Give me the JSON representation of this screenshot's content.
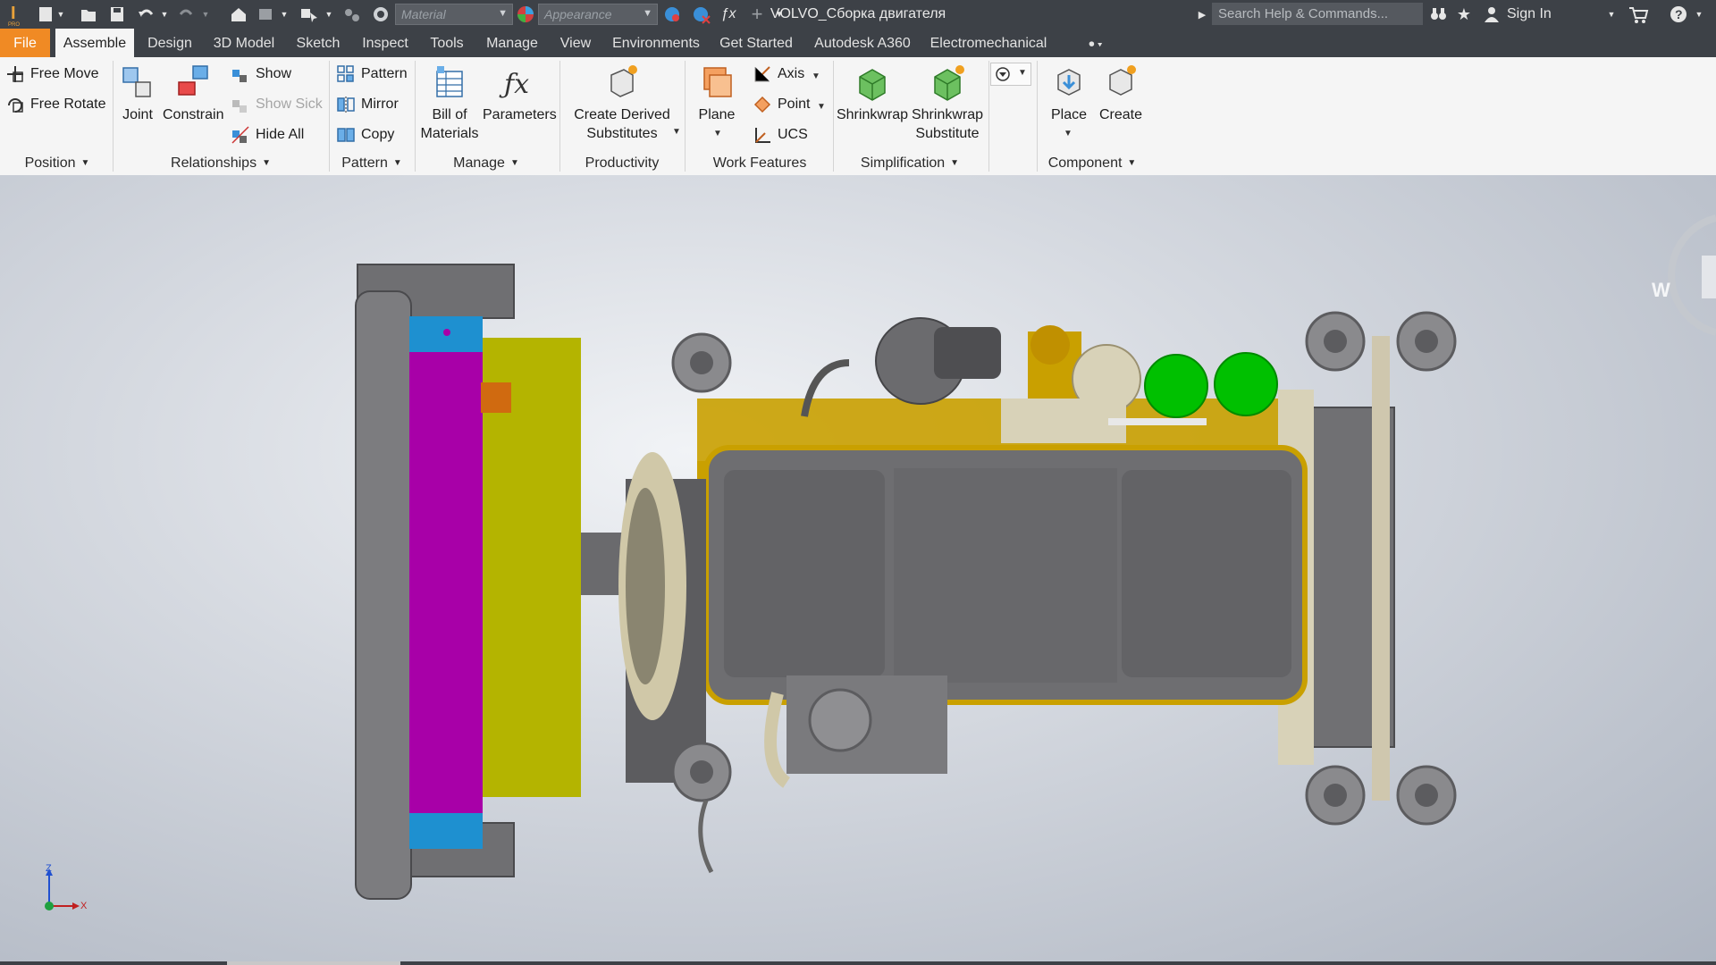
{
  "titlebar": {
    "document_title": "VOLVO_Сборка двигателя",
    "material_placeholder": "Material",
    "appearance_placeholder": "Appearance",
    "search_placeholder": "Search Help & Commands...",
    "sign_in": "Sign In"
  },
  "tabs": [
    "File",
    "Assemble",
    "Design",
    "3D Model",
    "Sketch",
    "Inspect",
    "Tools",
    "Manage",
    "View",
    "Environments",
    "Get Started",
    "Autodesk A360",
    "Electromechanical"
  ],
  "active_tab": "Assemble",
  "ribbon": {
    "position": {
      "free_move": "Free Move",
      "free_rotate": "Free Rotate",
      "label": "Position"
    },
    "relationships": {
      "joint": "Joint",
      "constrain": "Constrain",
      "show": "Show",
      "show_sick": "Show Sick",
      "hide_all": "Hide All",
      "label": "Relationships"
    },
    "pattern": {
      "pattern": "Pattern",
      "mirror": "Mirror",
      "copy": "Copy",
      "label": "Pattern"
    },
    "manage": {
      "bom_line1": "Bill of",
      "bom_line2": "Materials",
      "parameters": "Parameters",
      "label": "Manage"
    },
    "productivity": {
      "cds_line1": "Create Derived",
      "cds_line2": "Substitutes",
      "label": "Productivity"
    },
    "work_features": {
      "plane": "Plane",
      "axis": "Axis",
      "point": "Point",
      "ucs": "UCS",
      "label": "Work Features"
    },
    "simplification": {
      "shrinkwrap": "Shrinkwrap",
      "sws_line1": "Shrinkwrap",
      "sws_line2": "Substitute",
      "label": "Simplification"
    },
    "component": {
      "place": "Place",
      "create": "Create",
      "label": "Component"
    }
  },
  "viewport": {
    "viewcube_face": "W",
    "axis_z": "Z",
    "axis_x": "X"
  },
  "colors": {
    "ribbon_bg": "#f5f5f5",
    "titlebar_bg": "#3d4147",
    "file_tab": "#f08a24",
    "radiator_core": "#a800a8",
    "radiator_caps": "#1e90d0",
    "radiator_shroud": "#b4b400",
    "engine_block": "#6e6e6e",
    "engine_accent": "#c9a000",
    "green_parts": "#00c000"
  }
}
